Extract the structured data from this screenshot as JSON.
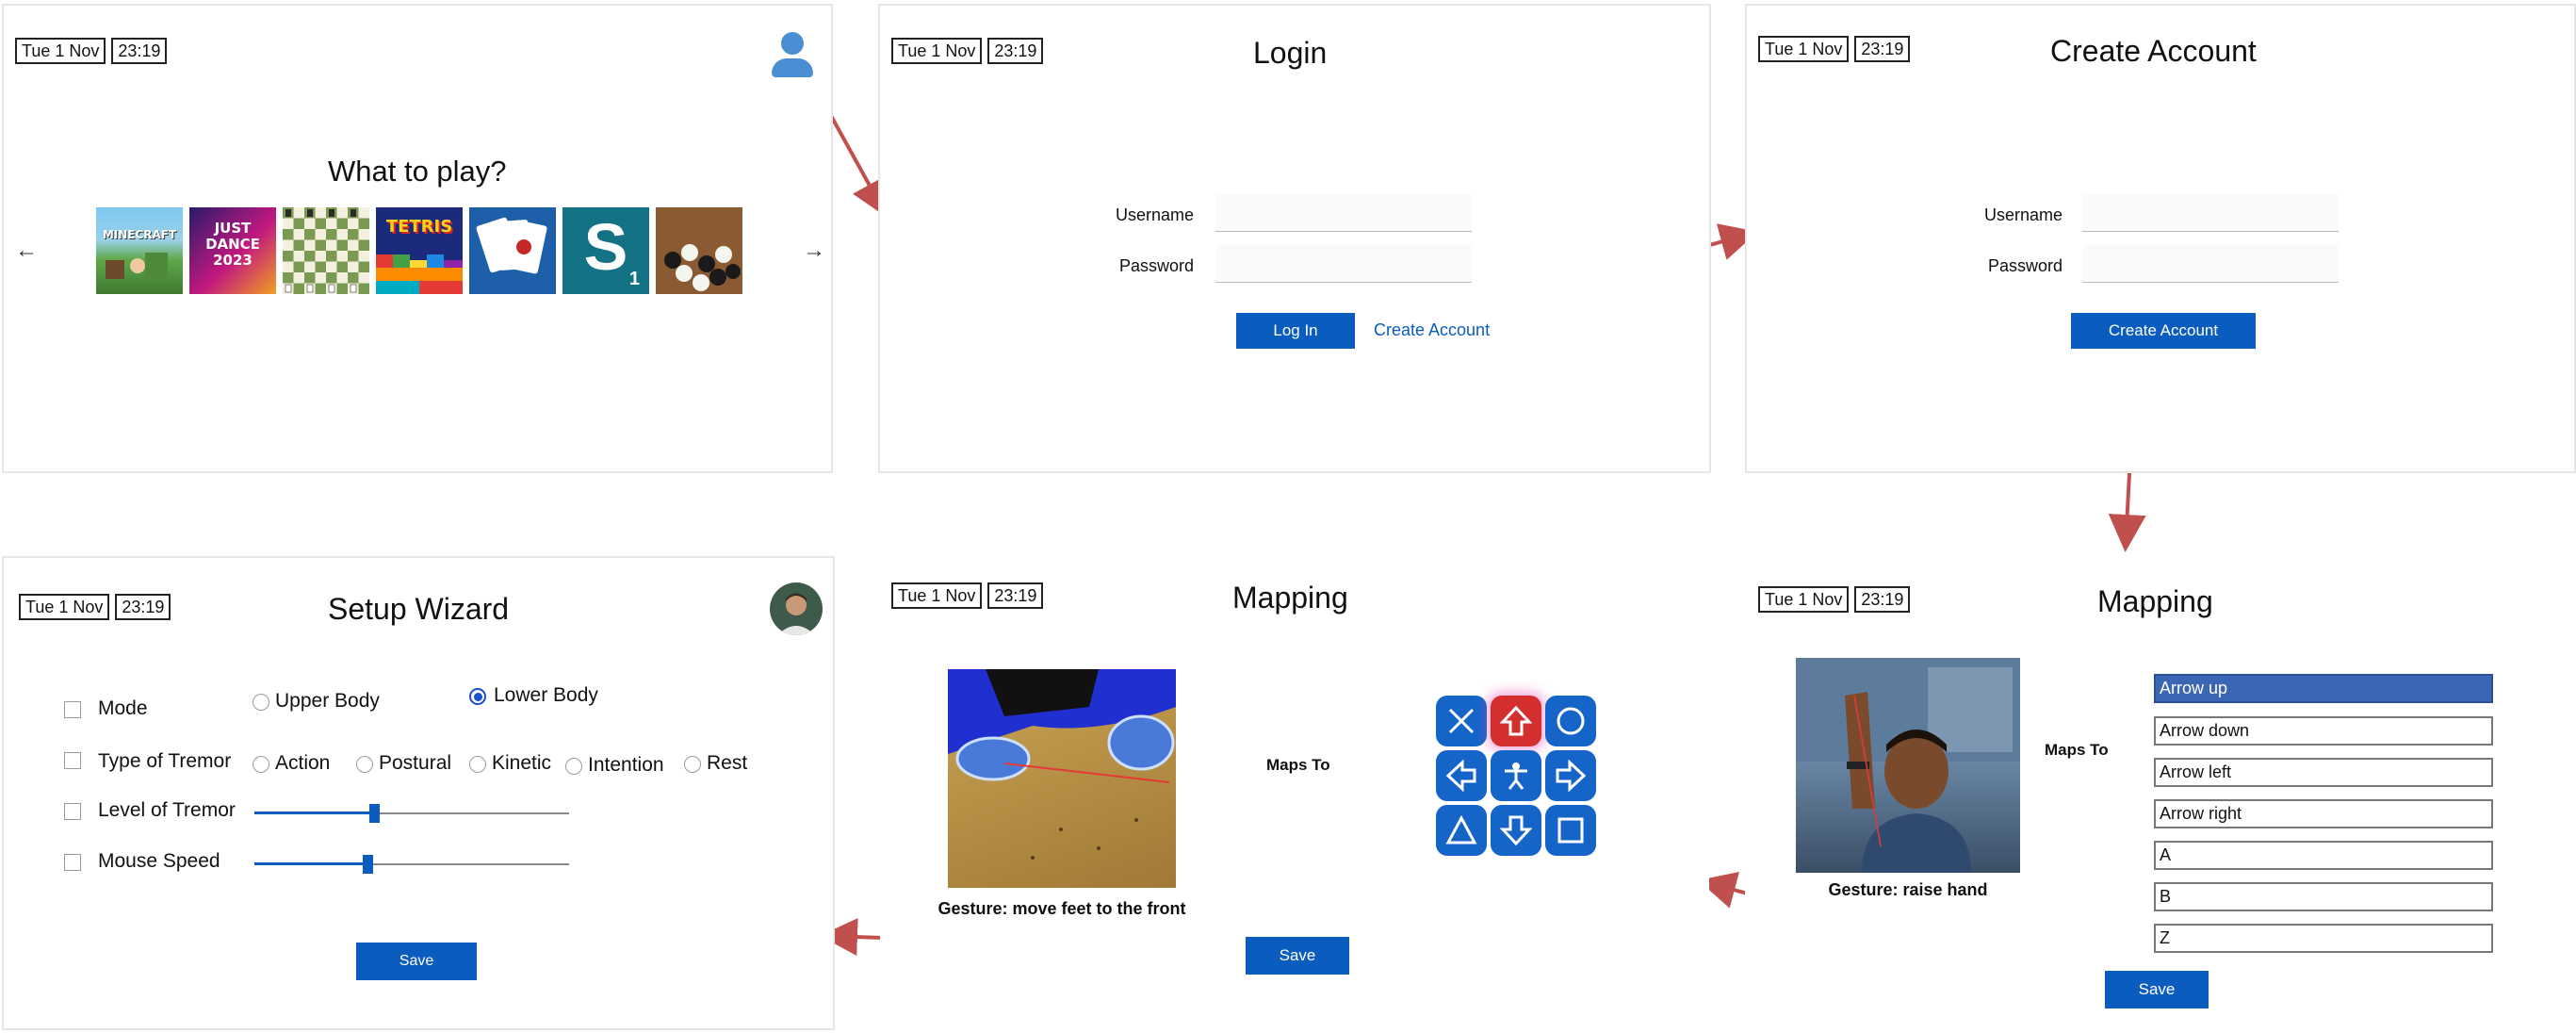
{
  "colors": {
    "accent": "#0b5cbf",
    "flow_arrow": "#c0504d",
    "selected_option": "#3a66b3",
    "pad_button": "#1565c8",
    "pad_active": "#d32f2f"
  },
  "datetime": {
    "date": "Tue 1 Nov",
    "time": "23:19"
  },
  "home": {
    "title": "What to play?",
    "prev_icon": "←",
    "next_icon": "→",
    "games": [
      {
        "name": "minecraft",
        "label": "MINECRAFT"
      },
      {
        "name": "just-dance",
        "label": "JUST DANCE 2023"
      },
      {
        "name": "chess",
        "label": ""
      },
      {
        "name": "tetris",
        "label": "TETRIS"
      },
      {
        "name": "cards",
        "label": ""
      },
      {
        "name": "scrabble",
        "label": "S",
        "sub": "1"
      },
      {
        "name": "go",
        "label": ""
      }
    ]
  },
  "login": {
    "title": "Login",
    "username_label": "Username",
    "password_label": "Password",
    "login_button": "Log In",
    "create_link": "Create Account"
  },
  "create_account": {
    "title": "Create Account",
    "username_label": "Username",
    "password_label": "Password",
    "submit_button": "Create Account"
  },
  "wizard": {
    "title": "Setup Wizard",
    "mode_label": "Mode",
    "mode_options": [
      "Upper Body",
      "Lower Body"
    ],
    "mode_selected": "Lower Body",
    "tremor_type_label": "Type of Tremor",
    "tremor_types": [
      "Action",
      "Postural",
      "Kinetic",
      "Intention",
      "Rest"
    ],
    "tremor_level_label": "Level of Tremor",
    "tremor_level": 0.38,
    "mouse_speed_label": "Mouse Speed",
    "mouse_speed": 0.36,
    "save_button": "Save"
  },
  "mapping_feet": {
    "title": "Mapping",
    "maps_to": "Maps To",
    "caption": "Gesture: move feet to the front",
    "save_button": "Save",
    "pad": {
      "buttons": [
        "X",
        "arrow-up",
        "O",
        "arrow-left",
        "person",
        "arrow-right",
        "triangle",
        "arrow-down",
        "square"
      ],
      "active": "arrow-up"
    }
  },
  "mapping_hand": {
    "title": "Mapping",
    "maps_to": "Maps To",
    "caption": "Gesture: raise hand",
    "save_button": "Save",
    "options": [
      "Arrow up",
      "Arrow down",
      "Arrow left",
      "Arrow right",
      "A",
      "B",
      "Z"
    ],
    "selected": "Arrow up"
  }
}
